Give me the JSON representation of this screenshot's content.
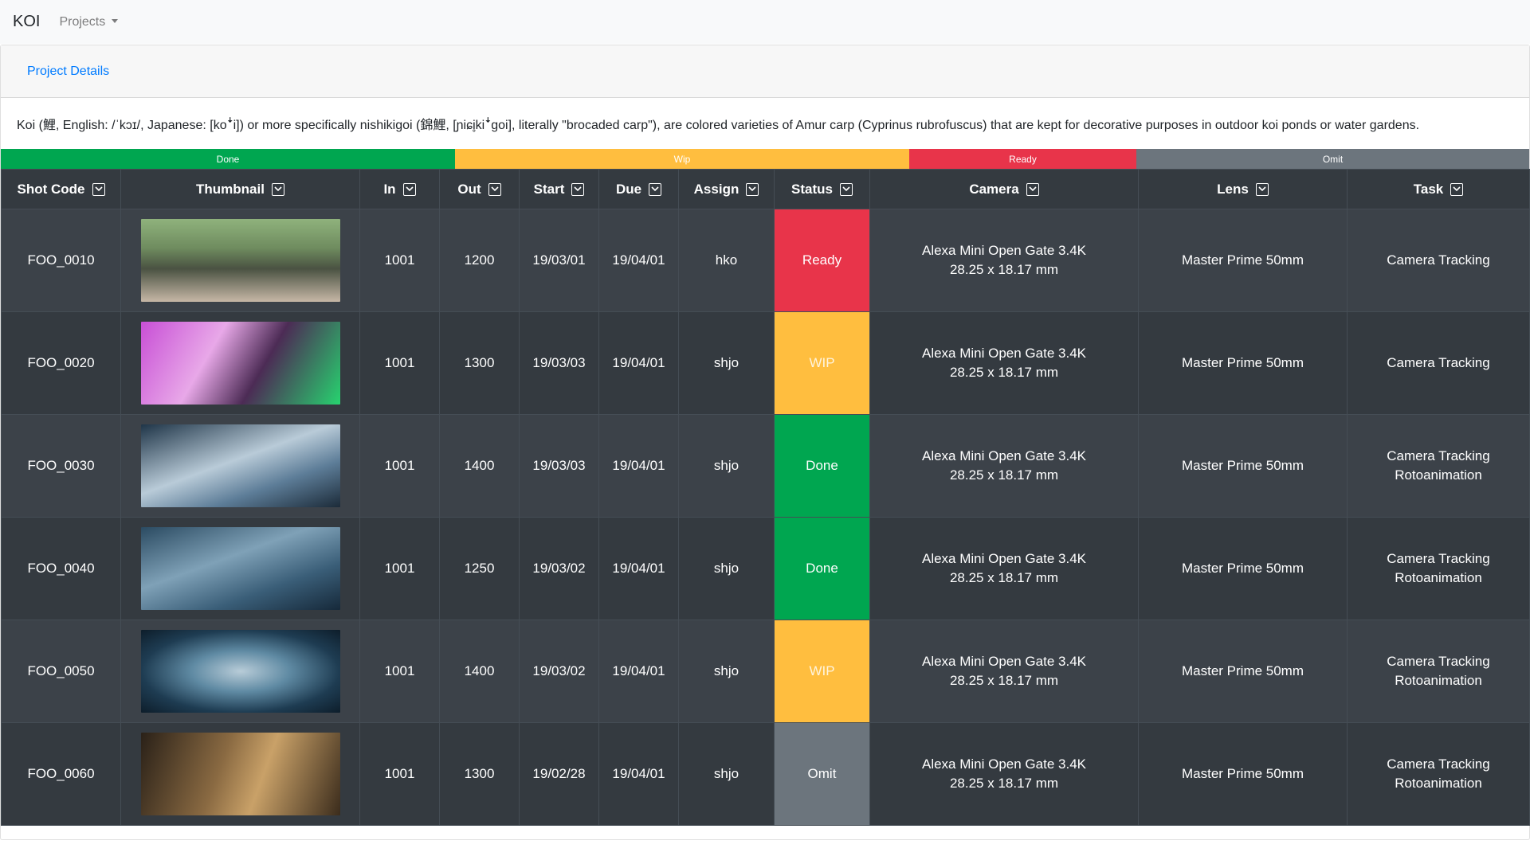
{
  "navbar": {
    "brand": "KOI",
    "projects_label": "Projects"
  },
  "card": {
    "header_link": "Project Details",
    "description": "Koi (鯉, English: /ˈkɔɪ/, Japanese: [koꜜi]) or more specifically nishikigoi (錦鯉, [ɲiɕi̥kiꜜgoi], literally \"brocaded carp\"), are colored varieties of Amur carp (Cyprinus rubrofuscus) that are kept for decorative purposes in outdoor koi ponds or water gardens."
  },
  "progress": [
    {
      "label": "Done",
      "fraction": 0.3333,
      "color": "#00a650"
    },
    {
      "label": "Wip",
      "fraction": 0.3333,
      "color": "#ffbe3f"
    },
    {
      "label": "Ready",
      "fraction": 0.1667,
      "color": "#e8344a"
    },
    {
      "label": "Omit",
      "fraction": 0.1667,
      "color": "#6c757d"
    }
  ],
  "table": {
    "columns": [
      "Shot Code",
      "Thumbnail",
      "In",
      "Out",
      "Start",
      "Due",
      "Assign",
      "Status",
      "Camera",
      "Lens",
      "Task"
    ],
    "rows": [
      {
        "shot_code": "FOO_0010",
        "thumb_icon": "thumbnail-image",
        "in": "1001",
        "out": "1200",
        "start": "19/03/01",
        "due": "19/04/01",
        "assign": "hko",
        "status": "Ready",
        "camera_1": "Alexa Mini Open Gate 3.4K",
        "camera_2": "28.25 x 18.17 mm",
        "lens": "Master Prime 50mm",
        "task_1": "Camera Tracking",
        "task_2": ""
      },
      {
        "shot_code": "FOO_0020",
        "thumb_icon": "thumbnail-image",
        "in": "1001",
        "out": "1300",
        "start": "19/03/03",
        "due": "19/04/01",
        "assign": "shjo",
        "status": "WIP",
        "camera_1": "Alexa Mini Open Gate 3.4K",
        "camera_2": "28.25 x 18.17 mm",
        "lens": "Master Prime 50mm",
        "task_1": "Camera Tracking",
        "task_2": ""
      },
      {
        "shot_code": "FOO_0030",
        "thumb_icon": "thumbnail-image",
        "in": "1001",
        "out": "1400",
        "start": "19/03/03",
        "due": "19/04/01",
        "assign": "shjo",
        "status": "Done",
        "camera_1": "Alexa Mini Open Gate 3.4K",
        "camera_2": "28.25 x 18.17 mm",
        "lens": "Master Prime 50mm",
        "task_1": "Camera Tracking",
        "task_2": "Rotoanimation"
      },
      {
        "shot_code": "FOO_0040",
        "thumb_icon": "thumbnail-image",
        "in": "1001",
        "out": "1250",
        "start": "19/03/02",
        "due": "19/04/01",
        "assign": "shjo",
        "status": "Done",
        "camera_1": "Alexa Mini Open Gate 3.4K",
        "camera_2": "28.25 x 18.17 mm",
        "lens": "Master Prime 50mm",
        "task_1": "Camera Tracking",
        "task_2": "Rotoanimation"
      },
      {
        "shot_code": "FOO_0050",
        "thumb_icon": "thumbnail-image",
        "in": "1001",
        "out": "1400",
        "start": "19/03/02",
        "due": "19/04/01",
        "assign": "shjo",
        "status": "WIP",
        "camera_1": "Alexa Mini Open Gate 3.4K",
        "camera_2": "28.25 x 18.17 mm",
        "lens": "Master Prime 50mm",
        "task_1": "Camera Tracking",
        "task_2": "Rotoanimation"
      },
      {
        "shot_code": "FOO_0060",
        "thumb_icon": "thumbnail-image",
        "in": "1001",
        "out": "1300",
        "start": "19/02/28",
        "due": "19/04/01",
        "assign": "shjo",
        "status": "Omit",
        "camera_1": "Alexa Mini Open Gate 3.4K",
        "camera_2": "28.25 x 18.17 mm",
        "lens": "Master Prime 50mm",
        "task_1": "Camera Tracking",
        "task_2": "Rotoanimation"
      }
    ]
  },
  "colors": {
    "done": "#00a650",
    "wip": "#ffbe3f",
    "ready": "#e8344a",
    "omit": "#6c757d",
    "table_header": "#343a40",
    "link": "#007bff"
  }
}
